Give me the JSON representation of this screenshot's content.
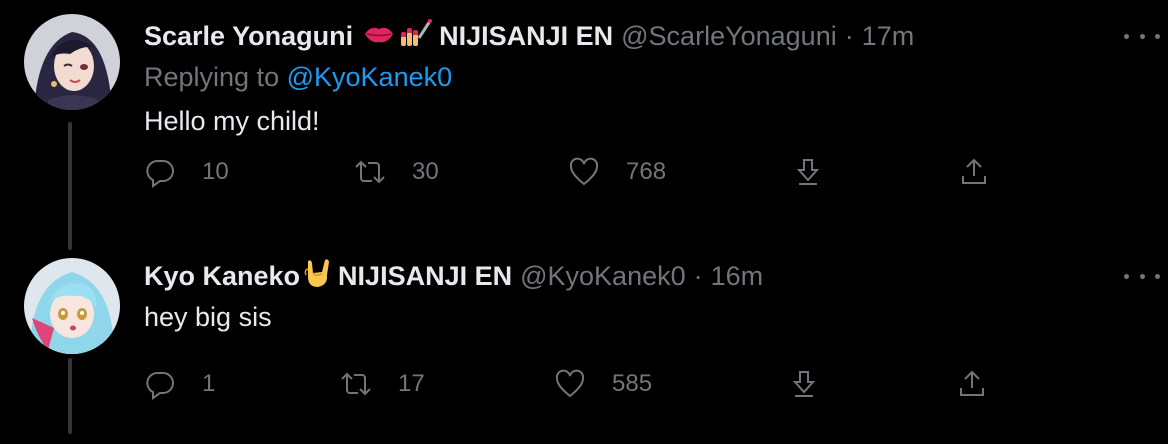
{
  "tweets": [
    {
      "name": "Scarle Yonaguni",
      "emojis": [
        "lips-emoji",
        "nail-polish-emoji"
      ],
      "suffix": "NIJISANJI EN",
      "handle": "@ScarleYonaguni",
      "separator": "·",
      "time": "17m",
      "replying_prefix": "Replying to",
      "replying_to": "@KyoKanek0",
      "text": "Hello my child!",
      "replies": "10",
      "retweets": "30",
      "likes": "768"
    },
    {
      "name": "Kyo Kaneko",
      "emojis": [
        "rock-on-hand-emoji"
      ],
      "suffix": "NIJISANJI EN",
      "handle": "@KyoKanek0",
      "separator": "·",
      "time": "16m",
      "text": "hey big sis",
      "replies": "1",
      "retweets": "17",
      "likes": "585"
    }
  ],
  "colors": {
    "background": "#000000",
    "text": "#e7e9ea",
    "muted": "#71767b",
    "link": "#1d9bf0",
    "thread_line": "#333639"
  },
  "icons": [
    "reply-icon",
    "retweet-icon",
    "like-icon",
    "bookmark-icon",
    "share-icon",
    "more-icon"
  ]
}
